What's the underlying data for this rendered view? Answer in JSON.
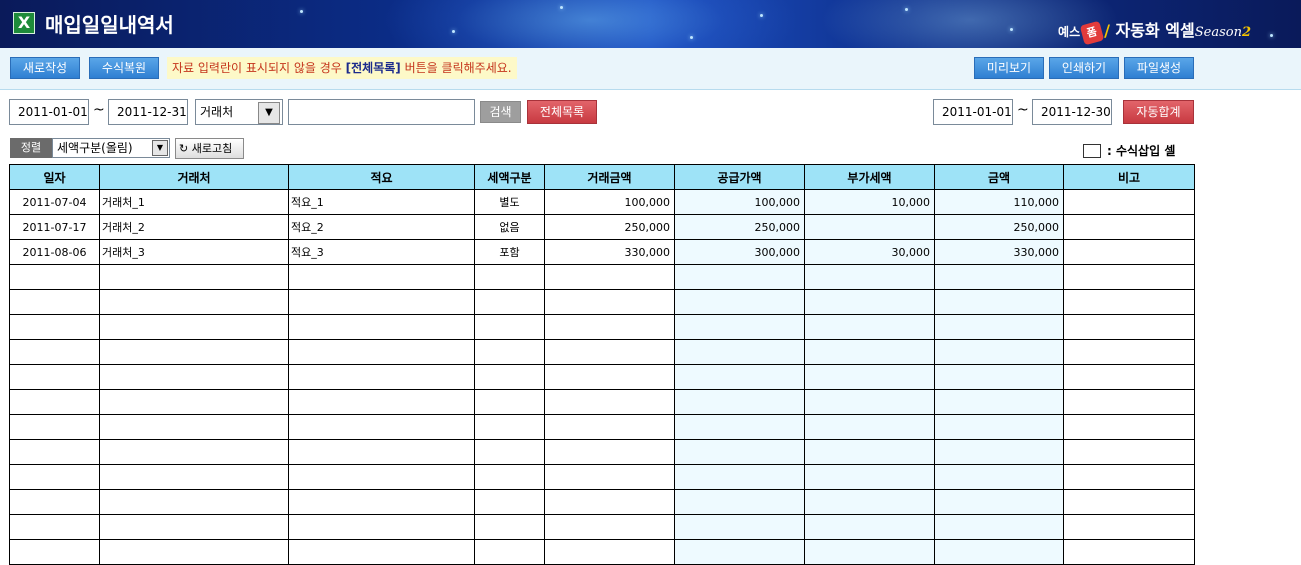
{
  "header": {
    "title": "매입일일내역서",
    "brand_prefix": "예스",
    "brand_mark": "폼",
    "brand_name": "자동화 엑셀",
    "brand_season_word": "Season",
    "brand_season_num": "2"
  },
  "toolbar": {
    "new_label": "새로작성",
    "restore_label": "수식복원",
    "notice_before": "자료 입력란이 표시되지  않을 경우 ",
    "notice_bold": "[전체목록]",
    "notice_after": " 버튼을 클릭해주세요.",
    "preview_label": "미리보기",
    "print_label": "인쇄하기",
    "file_label": "파일생성"
  },
  "search": {
    "date_from": "2011-01-01",
    "tilde": "~",
    "date_to": "2011-12-31",
    "field_select": "거래처",
    "keyword": "",
    "search_label": "검색",
    "all_list_label": "전체목록",
    "sum_from": "2011-01-01",
    "sum_to": "2011-12-30",
    "auto_sum_label": "자동합계"
  },
  "sort": {
    "label": "정렬",
    "value": "세액구분(올림)",
    "refresh_label": "새로고침"
  },
  "legend": {
    "text": ": 수식삽입 셀"
  },
  "table": {
    "columns": [
      "일자",
      "거래처",
      "적요",
      "세액구분",
      "거래금액",
      "공급가액",
      "부가세액",
      "금액",
      "비고"
    ],
    "rows": [
      [
        "2011-07-04",
        "거래처_1",
        "적요_1",
        "별도",
        "100,000",
        "100,000",
        "10,000",
        "110,000",
        ""
      ],
      [
        "2011-07-17",
        "거래처_2",
        "적요_2",
        "없음",
        "250,000",
        "250,000",
        "",
        "250,000",
        ""
      ],
      [
        "2011-08-06",
        "거래처_3",
        "적요_3",
        "포함",
        "330,000",
        "300,000",
        "30,000",
        "330,000",
        ""
      ],
      [
        "",
        "",
        "",
        "",
        "",
        "",
        "",
        "",
        ""
      ],
      [
        "",
        "",
        "",
        "",
        "",
        "",
        "",
        "",
        ""
      ],
      [
        "",
        "",
        "",
        "",
        "",
        "",
        "",
        "",
        ""
      ],
      [
        "",
        "",
        "",
        "",
        "",
        "",
        "",
        "",
        ""
      ],
      [
        "",
        "",
        "",
        "",
        "",
        "",
        "",
        "",
        ""
      ],
      [
        "",
        "",
        "",
        "",
        "",
        "",
        "",
        "",
        ""
      ],
      [
        "",
        "",
        "",
        "",
        "",
        "",
        "",
        "",
        ""
      ],
      [
        "",
        "",
        "",
        "",
        "",
        "",
        "",
        "",
        ""
      ],
      [
        "",
        "",
        "",
        "",
        "",
        "",
        "",
        "",
        ""
      ],
      [
        "",
        "",
        "",
        "",
        "",
        "",
        "",
        "",
        ""
      ],
      [
        "",
        "",
        "",
        "",
        "",
        "",
        "",
        "",
        ""
      ],
      [
        "",
        "",
        "",
        "",
        "",
        "",
        "",
        "",
        ""
      ]
    ]
  },
  "colors": {
    "header_fill": "#9ee3f7",
    "formula_cell": "#eefaff",
    "button_blue": "#2f7fd2",
    "button_red": "#c83a41"
  }
}
